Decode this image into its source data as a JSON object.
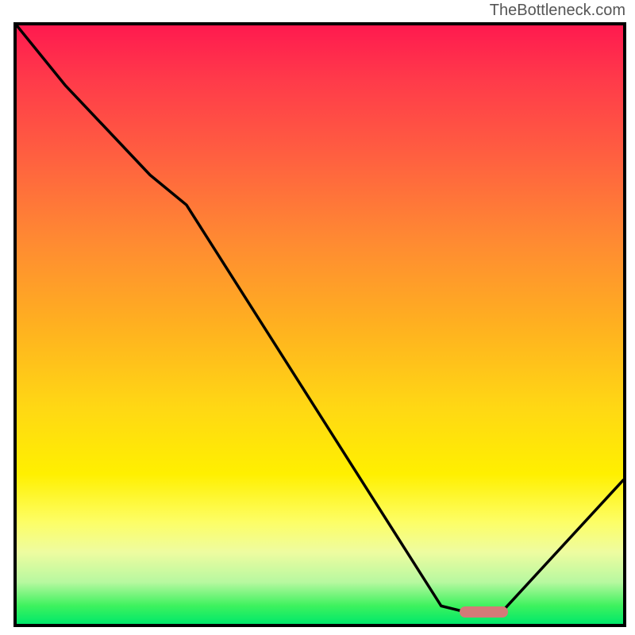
{
  "watermark": "TheBottleneck.com",
  "chart_data": {
    "type": "line",
    "title": "",
    "xlabel": "",
    "ylabel": "",
    "xlim": [
      0,
      100
    ],
    "ylim": [
      0,
      100
    ],
    "series": [
      {
        "name": "curve",
        "x": [
          0,
          8,
          22,
          28,
          70,
          74,
          80,
          100
        ],
        "y": [
          100,
          90,
          75,
          70,
          3,
          2,
          2,
          24
        ]
      }
    ],
    "marker": {
      "x_start": 73,
      "x_end": 81,
      "y": 2
    },
    "background_gradient": {
      "top": "#ff1a4f",
      "bottom": "#00e86a"
    }
  }
}
